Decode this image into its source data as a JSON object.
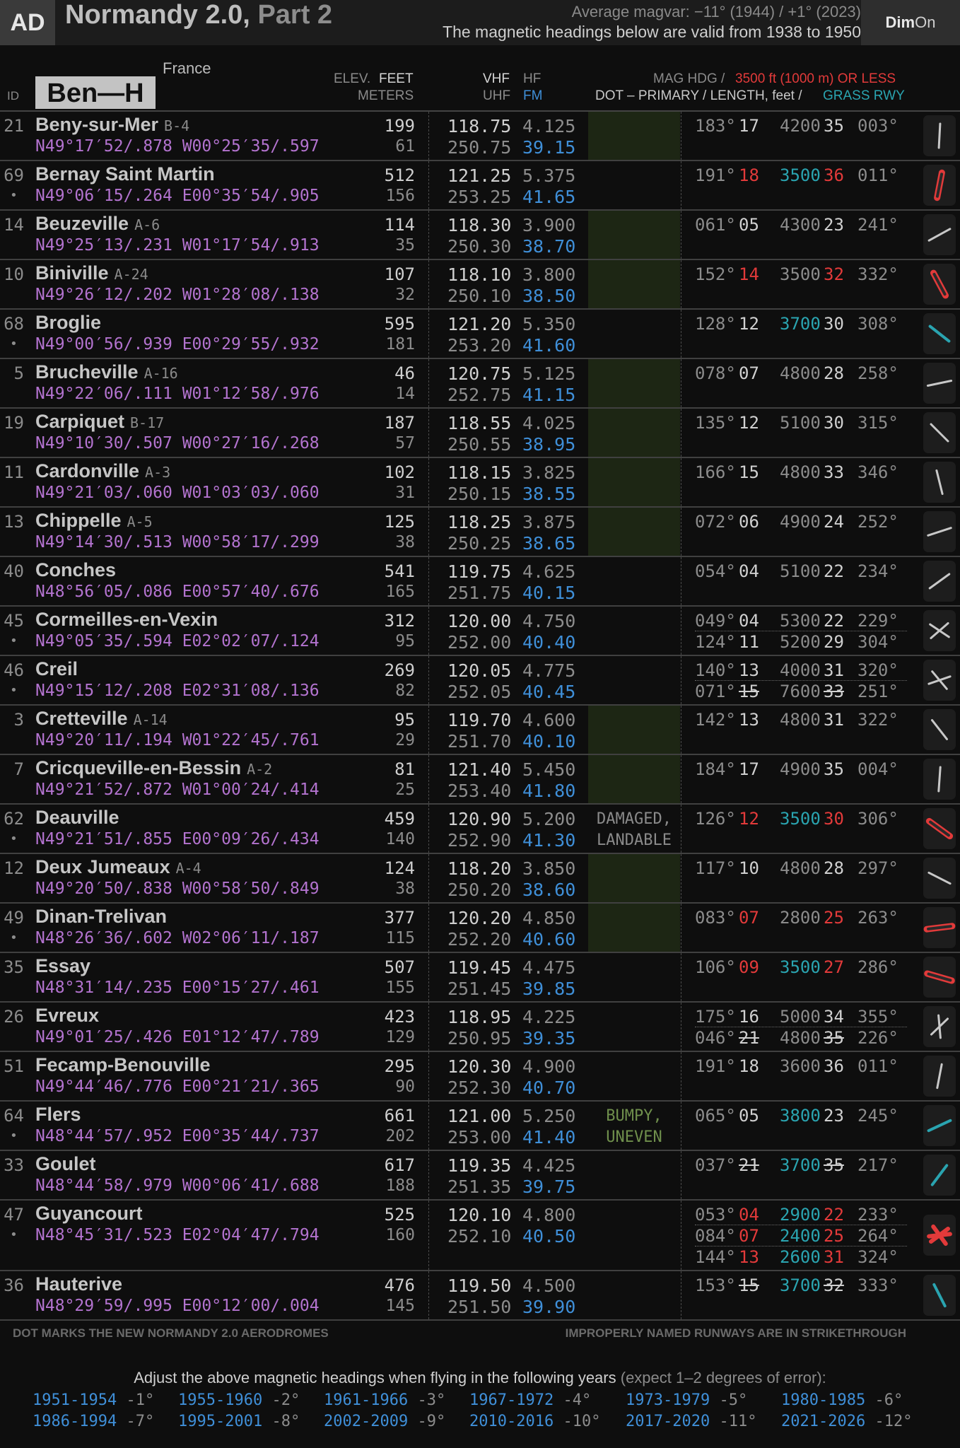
{
  "header": {
    "ad_label": "AD",
    "title": "Normandy 2.0,",
    "title_part": "Part 2",
    "magvar_line1": "Average magvar: −11° (1944) / +1° (2023)",
    "magvar_line2": "The magnetic headings below are valid from 1938 to 1950",
    "dim_label": "Dim",
    "dim_state": "On"
  },
  "columns": {
    "id": "ID",
    "region_tag": "Ben—H",
    "country": "France",
    "elev": "ELEV.",
    "feet": "FEET",
    "meters": "METERS",
    "vhf": "VHF",
    "hf": "HF",
    "uhf": "UHF",
    "fm": "FM",
    "mag_hdg": "MAG HDG /",
    "limit": "3500 ft (1000 m) OR LESS",
    "dot_primary": "DOT – PRIMARY / LENGTH, feet /",
    "grass": "GRASS RWY"
  },
  "airfields": [
    {
      "id": "21",
      "name": "Beny-sur-Mer",
      "code": "B-4",
      "dot": "",
      "coord": "N49°17′52/.878 W00°25′35/.597",
      "ft": "199",
      "m": "61",
      "vhf": "118.75",
      "hf": "4.125",
      "uhf": "250.75",
      "fm": "39.15",
      "green": true,
      "note": "",
      "runways": [
        {
          "h1": "183°",
          "n1": "17",
          "len": "4200",
          "n2": "35",
          "h2": "003°"
        }
      ],
      "icon": "rw-straight-icon"
    },
    {
      "id": "69",
      "name": "Bernay Saint Martin",
      "code": "",
      "dot": "•",
      "coord": "N49°06′15/.264 E00°35′54/.905",
      "ft": "512",
      "m": "156",
      "vhf": "121.25",
      "hf": "5.375",
      "uhf": "253.25",
      "fm": "41.65",
      "green": false,
      "note": "",
      "runways": [
        {
          "h1": "191°",
          "n1": "18",
          "len": "3500",
          "n2": "36",
          "h2": "011°",
          "r1": true,
          "r2": true,
          "t": true
        }
      ],
      "icon": "rw-short-icon"
    },
    {
      "id": "14",
      "name": "Beuzeville",
      "code": "A-6",
      "dot": "",
      "coord": "N49°25′13/.231 W01°17′54/.913",
      "ft": "114",
      "m": "35",
      "vhf": "118.30",
      "hf": "3.900",
      "uhf": "250.30",
      "fm": "38.70",
      "green": true,
      "note": "",
      "runways": [
        {
          "h1": "061°",
          "n1": "05",
          "len": "4300",
          "n2": "23",
          "h2": "241°"
        }
      ],
      "icon": "rw-straight-icon"
    },
    {
      "id": "10",
      "name": "Biniville",
      "code": "A-24",
      "dot": "",
      "coord": "N49°26′12/.202 W01°28′08/.138",
      "ft": "107",
      "m": "32",
      "vhf": "118.10",
      "hf": "3.800",
      "uhf": "250.10",
      "fm": "38.50",
      "green": true,
      "note": "",
      "runways": [
        {
          "h1": "152°",
          "n1": "14",
          "len": "3500",
          "n2": "32",
          "h2": "332°",
          "r1": true,
          "r2": true
        }
      ],
      "icon": "rw-short-icon"
    },
    {
      "id": "68",
      "name": "Broglie",
      "code": "",
      "dot": "•",
      "coord": "N49°00′56/.939 E00°29′55/.932",
      "ft": "595",
      "m": "181",
      "vhf": "121.20",
      "hf": "5.350",
      "uhf": "253.20",
      "fm": "41.60",
      "green": false,
      "note": "",
      "runways": [
        {
          "h1": "128°",
          "n1": "12",
          "len": "3700",
          "n2": "30",
          "h2": "308°",
          "t": true
        }
      ],
      "icon": "rw-grass-icon"
    },
    {
      "id": "5",
      "name": "Brucheville",
      "code": "A-16",
      "dot": "",
      "coord": "N49°22′06/.111 W01°12′58/.976",
      "ft": "46",
      "m": "14",
      "vhf": "120.75",
      "hf": "5.125",
      "uhf": "252.75",
      "fm": "41.15",
      "green": true,
      "note": "",
      "runways": [
        {
          "h1": "078°",
          "n1": "07",
          "len": "4800",
          "n2": "28",
          "h2": "258°"
        }
      ],
      "icon": "rw-straight-icon"
    },
    {
      "id": "19",
      "name": "Carpiquet",
      "code": "B-17",
      "dot": "",
      "coord": "N49°10′30/.507 W00°27′16/.268",
      "ft": "187",
      "m": "57",
      "vhf": "118.55",
      "hf": "4.025",
      "uhf": "250.55",
      "fm": "38.95",
      "green": true,
      "note": "",
      "runways": [
        {
          "h1": "135°",
          "n1": "12",
          "len": "5100",
          "n2": "30",
          "h2": "315°"
        }
      ],
      "icon": "rw-straight-icon"
    },
    {
      "id": "11",
      "name": "Cardonville",
      "code": "A-3",
      "dot": "",
      "coord": "N49°21′03/.060 W01°03′03/.060",
      "ft": "102",
      "m": "31",
      "vhf": "118.15",
      "hf": "3.825",
      "uhf": "250.15",
      "fm": "38.55",
      "green": true,
      "note": "",
      "runways": [
        {
          "h1": "166°",
          "n1": "15",
          "len": "4800",
          "n2": "33",
          "h2": "346°"
        }
      ],
      "icon": "rw-straight-icon"
    },
    {
      "id": "13",
      "name": "Chippelle",
      "code": "A-5",
      "dot": "",
      "coord": "N49°14′30/.513 W00°58′17/.299",
      "ft": "125",
      "m": "38",
      "vhf": "118.25",
      "hf": "3.875",
      "uhf": "250.25",
      "fm": "38.65",
      "green": true,
      "note": "",
      "runways": [
        {
          "h1": "072°",
          "n1": "06",
          "len": "4900",
          "n2": "24",
          "h2": "252°"
        }
      ],
      "icon": "rw-straight-icon"
    },
    {
      "id": "40",
      "name": "Conches",
      "code": "",
      "dot": "",
      "coord": "N48°56′05/.086 E00°57′40/.676",
      "ft": "541",
      "m": "165",
      "vhf": "119.75",
      "hf": "4.625",
      "uhf": "251.75",
      "fm": "40.15",
      "green": false,
      "note": "",
      "runways": [
        {
          "h1": "054°",
          "n1": "04",
          "len": "5100",
          "n2": "22",
          "h2": "234°"
        }
      ],
      "icon": "rw-straight-icon"
    },
    {
      "id": "45",
      "name": "Cormeilles-en-Vexin",
      "code": "",
      "dot": "•",
      "coord": "N49°05′35/.594 E02°02′07/.124",
      "ft": "312",
      "m": "95",
      "vhf": "120.00",
      "hf": "4.750",
      "uhf": "252.00",
      "fm": "40.40",
      "green": false,
      "note": "",
      "runways": [
        {
          "h1": "049°",
          "n1": "04",
          "len": "5300",
          "n2": "22",
          "h2": "229°",
          "p": true
        },
        {
          "h1": "124°",
          "n1": "11",
          "len": "5200",
          "n2": "29",
          "h2": "304°"
        }
      ],
      "icon": "rw-cross-icon"
    },
    {
      "id": "46",
      "name": "Creil",
      "code": "",
      "dot": "•",
      "coord": "N49°15′12/.208 E02°31′08/.136",
      "ft": "269",
      "m": "82",
      "vhf": "120.05",
      "hf": "4.775",
      "uhf": "252.05",
      "fm": "40.45",
      "green": false,
      "note": "",
      "runways": [
        {
          "h1": "140°",
          "n1": "13",
          "len": "4000",
          "n2": "31",
          "h2": "320°"
        },
        {
          "h1": "071°",
          "n1": "15",
          "len": "7600",
          "n2": "33",
          "h2": "251°",
          "p": true,
          "s": true
        }
      ],
      "icon": "rw-cross-icon"
    },
    {
      "id": "3",
      "name": "Cretteville",
      "code": "A-14",
      "dot": "",
      "coord": "N49°20′11/.194 W01°22′45/.761",
      "ft": "95",
      "m": "29",
      "vhf": "119.70",
      "hf": "4.600",
      "uhf": "251.70",
      "fm": "40.10",
      "green": true,
      "note": "",
      "runways": [
        {
          "h1": "142°",
          "n1": "13",
          "len": "4800",
          "n2": "31",
          "h2": "322°"
        }
      ],
      "icon": "rw-straight-icon"
    },
    {
      "id": "7",
      "name": "Cricqueville-en-Bessin",
      "code": "A-2",
      "dot": "",
      "coord": "N49°21′52/.872 W01°00′24/.414",
      "ft": "81",
      "m": "25",
      "vhf": "121.40",
      "hf": "5.450",
      "uhf": "253.40",
      "fm": "41.80",
      "green": true,
      "note": "",
      "runways": [
        {
          "h1": "184°",
          "n1": "17",
          "len": "4900",
          "n2": "35",
          "h2": "004°"
        }
      ],
      "icon": "rw-straight-icon"
    },
    {
      "id": "62",
      "name": "Deauville",
      "code": "",
      "dot": "•",
      "coord": "N49°21′51/.855 E00°09′26/.434",
      "ft": "459",
      "m": "140",
      "vhf": "120.90",
      "hf": "5.200",
      "uhf": "252.90",
      "fm": "41.30",
      "green": false,
      "note": "DAMAGED, LANDABLE",
      "note_g": false,
      "runways": [
        {
          "h1": "126°",
          "n1": "12",
          "len": "3500",
          "n2": "30",
          "h2": "306°",
          "r1": true,
          "r2": true,
          "t": true
        }
      ],
      "icon": "rw-short-icon"
    },
    {
      "id": "12",
      "name": "Deux Jumeaux",
      "code": "A-4",
      "dot": "",
      "coord": "N49°20′50/.838 W00°58′50/.849",
      "ft": "124",
      "m": "38",
      "vhf": "118.20",
      "hf": "3.850",
      "uhf": "250.20",
      "fm": "38.60",
      "green": true,
      "note": "",
      "runways": [
        {
          "h1": "117°",
          "n1": "10",
          "len": "4800",
          "n2": "28",
          "h2": "297°"
        }
      ],
      "icon": "rw-straight-icon"
    },
    {
      "id": "49",
      "name": "Dinan-Trelivan",
      "code": "",
      "dot": "•",
      "coord": "N48°26′36/.602 W02°06′11/.187",
      "ft": "377",
      "m": "115",
      "vhf": "120.20",
      "hf": "4.850",
      "uhf": "252.20",
      "fm": "40.60",
      "green": true,
      "note": "",
      "runways": [
        {
          "h1": "083°",
          "n1": "07",
          "len": "2800",
          "n2": "25",
          "h2": "263°",
          "r1": true,
          "r2": true
        }
      ],
      "icon": "rw-short-icon"
    },
    {
      "id": "35",
      "name": "Essay",
      "code": "",
      "dot": "",
      "coord": "N48°31′14/.235 E00°15′27/.461",
      "ft": "507",
      "m": "155",
      "vhf": "119.45",
      "hf": "4.475",
      "uhf": "251.45",
      "fm": "39.85",
      "green": false,
      "note": "",
      "runways": [
        {
          "h1": "106°",
          "n1": "09",
          "len": "3500",
          "n2": "27",
          "h2": "286°",
          "r1": true,
          "r2": true,
          "t": true
        }
      ],
      "icon": "rw-short-icon"
    },
    {
      "id": "26",
      "name": "Evreux",
      "code": "",
      "dot": "",
      "coord": "N49°01′25/.426 E01°12′47/.789",
      "ft": "423",
      "m": "129",
      "vhf": "118.95",
      "hf": "4.225",
      "uhf": "250.95",
      "fm": "39.35",
      "green": false,
      "note": "",
      "runways": [
        {
          "h1": "175°",
          "n1": "16",
          "len": "5000",
          "n2": "34",
          "h2": "355°"
        },
        {
          "h1": "046°",
          "n1": "21",
          "len": "4800",
          "n2": "35",
          "h2": "226°",
          "p": true,
          "s": true
        }
      ],
      "icon": "rw-cross-icon"
    },
    {
      "id": "51",
      "name": "Fecamp-Benouville",
      "code": "",
      "dot": "",
      "coord": "N49°44′46/.776 E00°21′21/.365",
      "ft": "295",
      "m": "90",
      "vhf": "120.30",
      "hf": "4.900",
      "uhf": "252.30",
      "fm": "40.70",
      "green": false,
      "note": "",
      "runways": [
        {
          "h1": "191°",
          "n1": "18",
          "len": "3600",
          "n2": "36",
          "h2": "011°"
        }
      ],
      "icon": "rw-straight-icon"
    },
    {
      "id": "64",
      "name": "Flers",
      "code": "",
      "dot": "•",
      "coord": "N48°44′57/.952 E00°35′44/.737",
      "ft": "661",
      "m": "202",
      "vhf": "121.00",
      "hf": "5.250",
      "uhf": "253.00",
      "fm": "41.40",
      "green": false,
      "note": "BUMPY, UNEVEN",
      "note_g": true,
      "runways": [
        {
          "h1": "065°",
          "n1": "05",
          "len": "3800",
          "n2": "23",
          "h2": "245°",
          "t": true
        }
      ],
      "icon": "rw-grass-icon"
    },
    {
      "id": "33",
      "name": "Goulet",
      "code": "",
      "dot": "",
      "coord": "N48°44′58/.979 W00°06′41/.688",
      "ft": "617",
      "m": "188",
      "vhf": "119.35",
      "hf": "4.425",
      "uhf": "251.35",
      "fm": "39.75",
      "green": false,
      "note": "",
      "runways": [
        {
          "h1": "037°",
          "n1": "21",
          "len": "3700",
          "n2": "35",
          "h2": "217°",
          "t": true,
          "s": true
        }
      ],
      "icon": "rw-grass-icon"
    },
    {
      "id": "47",
      "name": "Guyancourt",
      "code": "",
      "dot": "•",
      "coord": "N48°45′31/.523 E02°04′47/.794",
      "ft": "525",
      "m": "160",
      "vhf": "120.10",
      "hf": "4.800",
      "uhf": "252.10",
      "fm": "40.50",
      "green": false,
      "note": "",
      "runways": [
        {
          "h1": "053°",
          "n1": "04",
          "len": "2900",
          "n2": "22",
          "h2": "233°",
          "r1": true,
          "r2": true,
          "t": true
        },
        {
          "h1": "084°",
          "n1": "07",
          "len": "2400",
          "n2": "25",
          "h2": "264°",
          "r1": true,
          "r2": true,
          "t": true
        },
        {
          "h1": "144°",
          "n1": "13",
          "len": "2600",
          "n2": "31",
          "h2": "324°",
          "r1": true,
          "r2": true,
          "t": true,
          "p": true
        }
      ],
      "icon": "rw-triple-icon"
    },
    {
      "id": "36",
      "name": "Hauterive",
      "code": "",
      "dot": "",
      "coord": "N48°29′59/.995 E00°12′00/.004",
      "ft": "476",
      "m": "145",
      "vhf": "119.50",
      "hf": "4.500",
      "uhf": "251.50",
      "fm": "39.90",
      "green": false,
      "note": "",
      "runways": [
        {
          "h1": "153°",
          "n1": "15",
          "len": "3700",
          "n2": "32",
          "h2": "333°",
          "t": true,
          "s": true
        }
      ],
      "icon": "rw-grass-icon"
    }
  ],
  "footer": {
    "dot_note": "DOT MARKS THE NEW NORMANDY 2.0 AERODROMES",
    "strike_note": "IMPROPERLY NAMED RUNWAYS ARE IN STRIKETHROUGH",
    "adjust_title": "Adjust the above magnetic headings when flying in the following years",
    "adjust_note": "(expect 1–2 degrees of error):",
    "corrections": [
      {
        "years": "1951-1954",
        "delta": "-1°"
      },
      {
        "years": "1955-1960",
        "delta": "-2°"
      },
      {
        "years": "1961-1966",
        "delta": "-3°"
      },
      {
        "years": "1967-1972",
        "delta": "-4°"
      },
      {
        "years": "1973-1979",
        "delta": "-5°"
      },
      {
        "years": "1980-1985",
        "delta": "-6°"
      },
      {
        "years": "1986-1994",
        "delta": "-7°"
      },
      {
        "years": "1995-2001",
        "delta": "-8°"
      },
      {
        "years": "2002-2009",
        "delta": "-9°"
      },
      {
        "years": "2010-2016",
        "delta": "-10°"
      },
      {
        "years": "2017-2020",
        "delta": "-11°"
      },
      {
        "years": "2021-2026",
        "delta": "-12°"
      }
    ]
  },
  "colors": {
    "accent_blue": "#3f8fd8",
    "coord_purple": "#b373cf",
    "short_red": "#e23a3a",
    "grass_teal": "#2aa4b0",
    "green_box": "#1d2614"
  }
}
